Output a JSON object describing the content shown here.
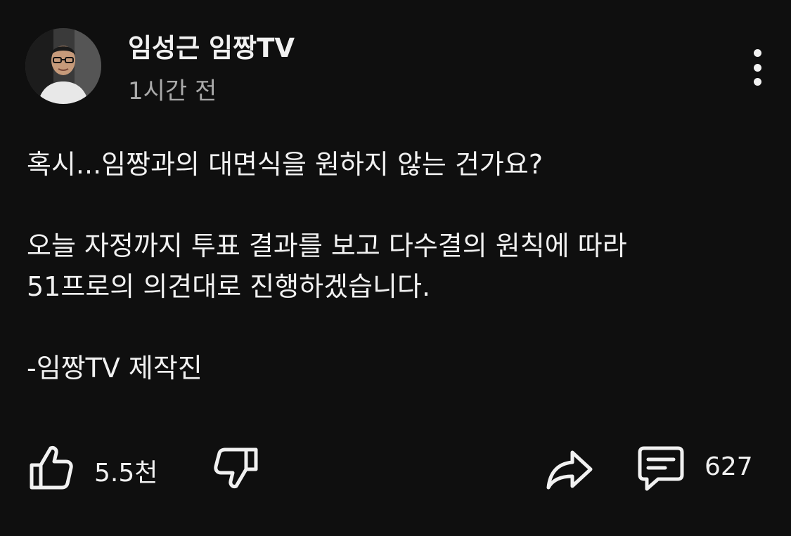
{
  "post": {
    "channel_name": "임성근 임짱TV",
    "time": "1시간 전",
    "body_lines": [
      "혹시...임짱과의 대면식을 원하지 않는 건가요?",
      "오늘 자정까지 투표 결과를 보고 다수결의 원칙에 따라",
      "51프로의 의견대로 진행하겠습니다.",
      "-임짱TV 제작진"
    ]
  },
  "actions": {
    "like_count": "5.5천",
    "comment_count": "627"
  },
  "icons": {
    "more": "more-vertical-icon",
    "like": "thumbs-up-icon",
    "dislike": "thumbs-down-icon",
    "share": "share-arrow-icon",
    "comment": "comment-icon"
  },
  "colors": {
    "background": "#0f0f0f",
    "text": "#f1f1f1",
    "secondary_text": "#aaaaaa"
  }
}
